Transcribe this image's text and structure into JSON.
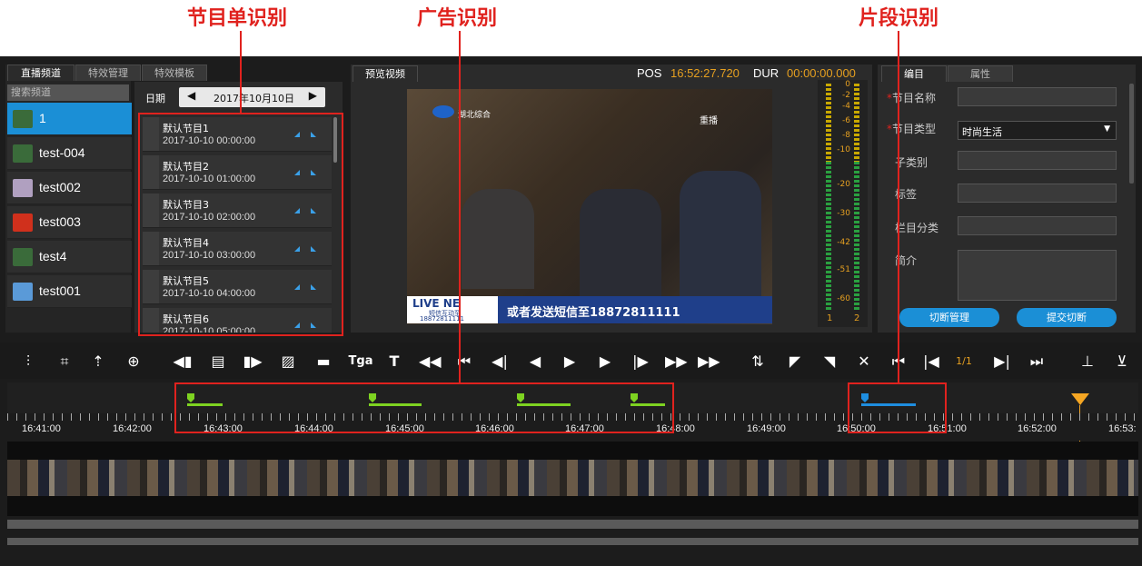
{
  "callouts": {
    "program_list": "节目单识别",
    "ad": "广告识别",
    "segment": "片段识别"
  },
  "left_tabs": [
    "直播频道",
    "特效管理",
    "特效模板"
  ],
  "channel_search_placeholder": "搜索频道",
  "channels": [
    "1",
    "test-004",
    "test002",
    "test003",
    "test4",
    "test001"
  ],
  "date": {
    "label": "日期",
    "value": "2017年10月10日"
  },
  "programs": [
    {
      "name": "默认节目1",
      "time": "2017-10-10 00:00:00"
    },
    {
      "name": "默认节目2",
      "time": "2017-10-10 01:00:00"
    },
    {
      "name": "默认节目3",
      "time": "2017-10-10 02:00:00"
    },
    {
      "name": "默认节目4",
      "time": "2017-10-10 03:00:00"
    },
    {
      "name": "默认节目5",
      "time": "2017-10-10 04:00:00"
    },
    {
      "name": "默认节目6",
      "time": "2017-10-10 05:00:00"
    }
  ],
  "preview": {
    "tab": "预览视频",
    "pos_label": "POS",
    "pos_value": "16:52:27.720",
    "dur_label": "DUR",
    "dur_value": "00:00:00.000",
    "logo_text": "湖北综合",
    "corner_text": "重播",
    "ticker_left": "LIVE NE",
    "ticker_sub": "短信互动至",
    "ticker_num": "18872811111",
    "ticker_text": "或者发送短信至18872811111"
  },
  "vu": {
    "scale": [
      "0",
      "-2",
      "-4",
      "-6",
      "-8",
      "-10",
      "-20",
      "-30",
      "-42",
      "-51",
      "-60"
    ],
    "channels": [
      "1",
      "2"
    ]
  },
  "right_tabs": [
    "编目",
    "属性"
  ],
  "form": {
    "program_name": "节目名称",
    "program_type": "节目类型",
    "program_type_value": "时尚生活",
    "subcategory": "子类别",
    "tags": "标签",
    "column_category": "栏目分类",
    "intro": "简介",
    "btn_manage": "切断管理",
    "btn_submit": "提交切断"
  },
  "toolbar": {
    "tga": "Tga",
    "page": "1/1"
  },
  "timeline": {
    "ticks": [
      "16:41:00",
      "16:42:00",
      "16:43:00",
      "16:44:00",
      "16:45:00",
      "16:46:00",
      "16:47:00",
      "16:48:00",
      "16:49:00",
      "16:50:00",
      "16:51:00",
      "16:52:00",
      "16:53:"
    ]
  },
  "colors": {
    "accent": "#1b8fd6",
    "ad_marker": "#7ed321",
    "segment_marker": "#1e8ee0",
    "playhead": "#f5a623",
    "callout": "#e0221e",
    "time": "#e6a020"
  }
}
